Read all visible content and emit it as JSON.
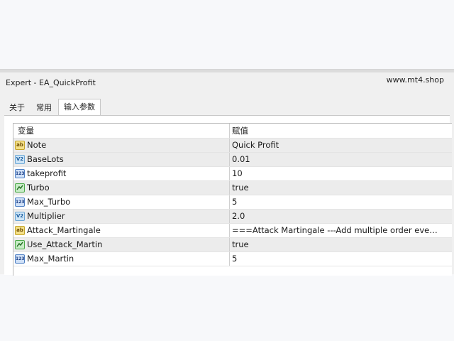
{
  "window": {
    "title": "Expert - EA_QuickProfit",
    "watermark": "www.mt4.shop"
  },
  "tabs": [
    {
      "label": "关于",
      "active": false
    },
    {
      "label": "常用",
      "active": false
    },
    {
      "label": "输入参数",
      "active": true
    }
  ],
  "table": {
    "headers": {
      "variable": "变量",
      "value": "赋值"
    },
    "rows": [
      {
        "icon": "string-icon",
        "type_badge": "ab",
        "name": "Note",
        "value": "Quick Profit"
      },
      {
        "icon": "double-icon",
        "type_badge": "V2",
        "name": "BaseLots",
        "value": "0.01"
      },
      {
        "icon": "integer-icon",
        "type_badge": "123",
        "name": "takeprofit",
        "value": "10"
      },
      {
        "icon": "bool-icon",
        "type_badge": "",
        "name": "Turbo",
        "value": "true"
      },
      {
        "icon": "integer-icon",
        "type_badge": "123",
        "name": "Max_Turbo",
        "value": "5"
      },
      {
        "icon": "double-icon",
        "type_badge": "V2",
        "name": "Multiplier",
        "value": "2.0"
      },
      {
        "icon": "string-icon",
        "type_badge": "ab",
        "name": "Attack_Martingale",
        "value": "===Attack Martingale ---Add multiple order every x..."
      },
      {
        "icon": "bool-icon",
        "type_badge": "",
        "name": "Use_Attack_Martin",
        "value": "true"
      },
      {
        "icon": "integer-icon",
        "type_badge": "123",
        "name": "Max_Martin",
        "value": "5"
      }
    ]
  }
}
